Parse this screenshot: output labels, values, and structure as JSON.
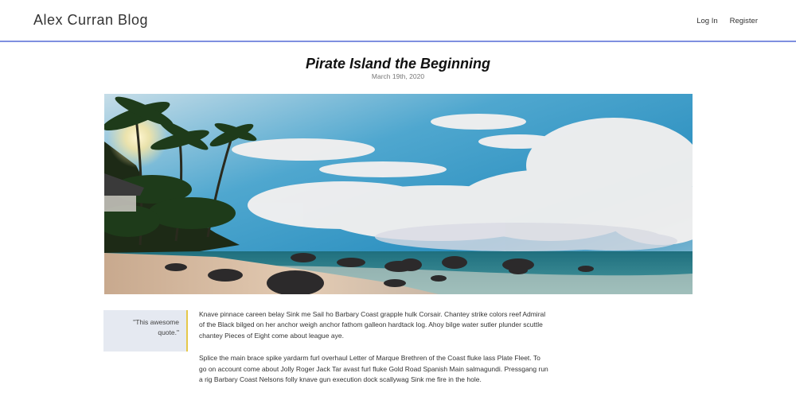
{
  "site": {
    "brand": "Alex Curran Blog",
    "nav": [
      {
        "label": "Log In"
      },
      {
        "label": "Register"
      }
    ],
    "accent_color": "#7f8fe0"
  },
  "post": {
    "title": "Pirate Island the Beginning",
    "date": "March 19th, 2020",
    "hero_image": "beach-with-palm-trees-photo",
    "quote": "\"This awesome quote.\"",
    "paragraphs": [
      "Knave pinnace careen belay Sink me Sail ho Barbary Coast grapple hulk Corsair. Chantey strike colors reef Admiral of the Black bilged on her anchor weigh anchor fathom galleon hardtack log. Ahoy bilge water sutler plunder scuttle chantey Pieces of Eight come about league aye.",
      "Splice the main brace spike yardarm furl overhaul Letter of Marque Brethren of the Coast fluke lass Plate Fleet. To go on account come about Jolly Roger Jack Tar avast furl fluke Gold Road Spanish Main salmagundi. Pressgang run a rig Barbary Coast Nelsons folly knave gun execution dock scallywag Sink me fire in the hole."
    ]
  }
}
